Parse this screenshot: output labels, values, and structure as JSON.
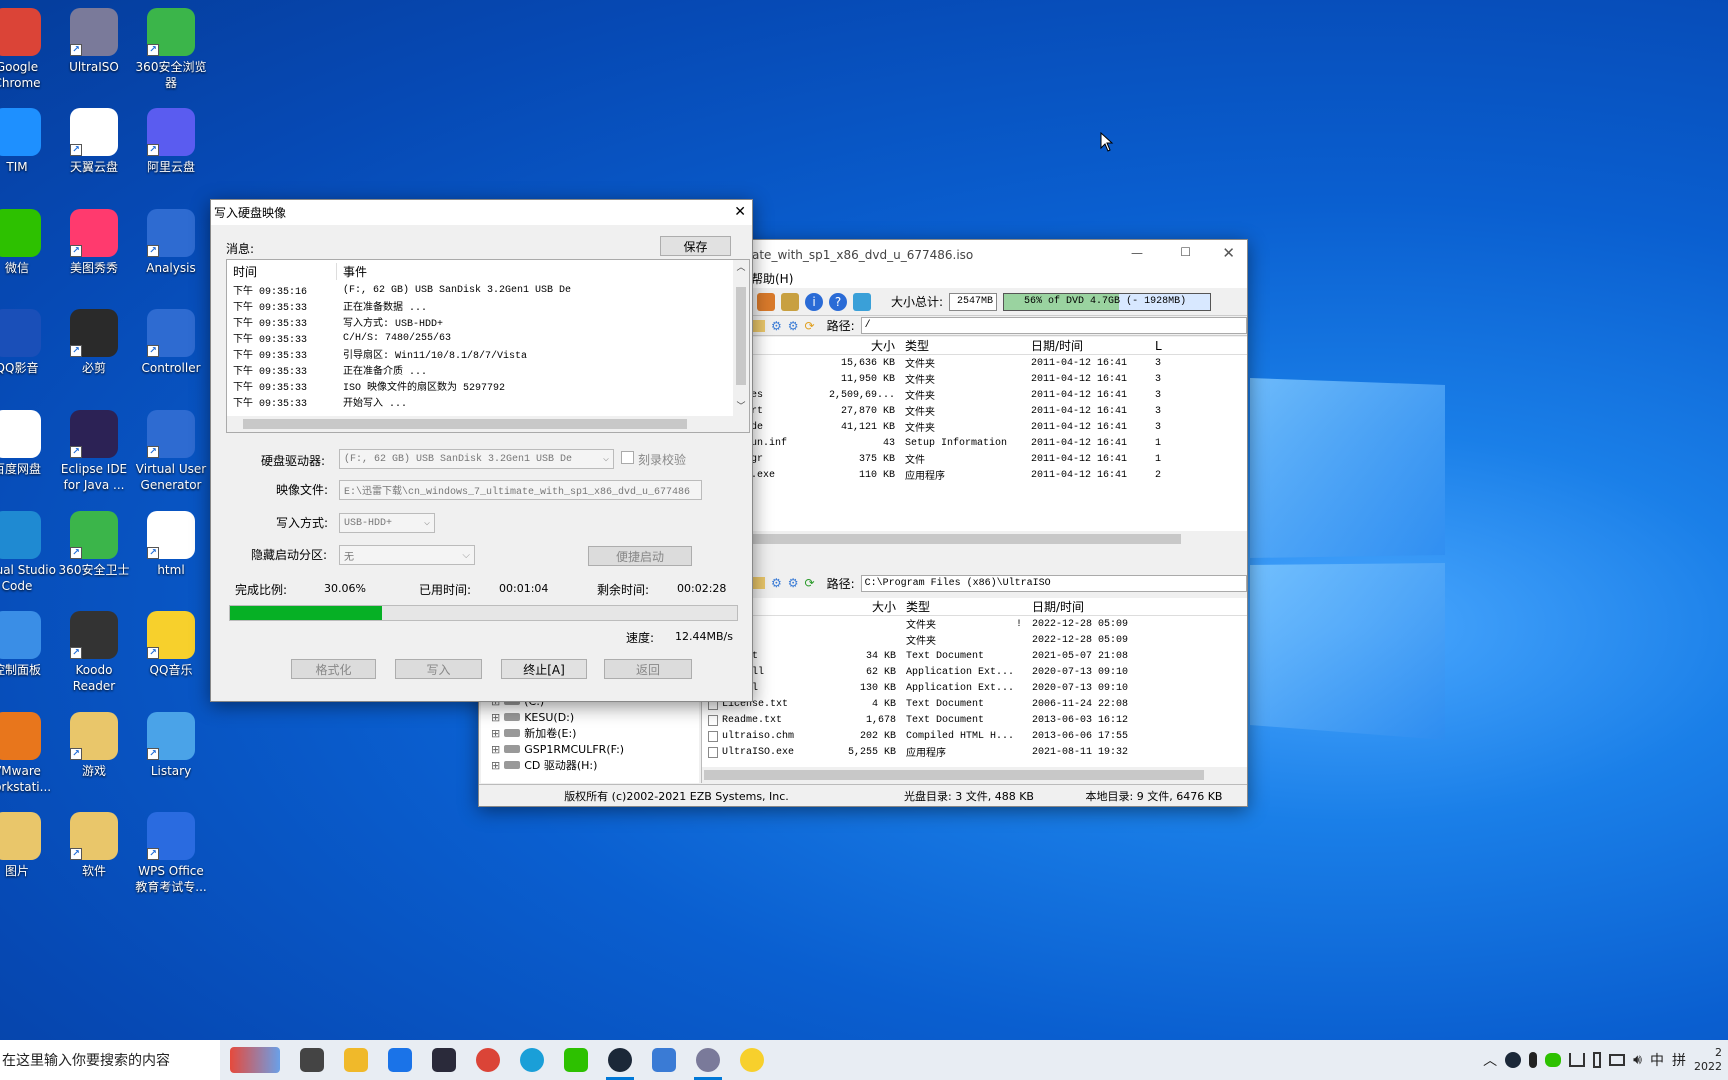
{
  "desktop_icons": [
    {
      "label": "Google Chrome",
      "color": "#db4437"
    },
    {
      "label": "UltraISO",
      "color": "#7a7a9a"
    },
    {
      "label": "360安全浏览器",
      "color": "#3bb54a"
    },
    {
      "label": "TIM",
      "color": "#1e90ff"
    },
    {
      "label": "天翼云盘",
      "color": "#ffffff"
    },
    {
      "label": "阿里云盘",
      "color": "#5a5cf0"
    },
    {
      "label": "微信",
      "color": "#2dc100"
    },
    {
      "label": "美图秀秀",
      "color": "#ff3a6e"
    },
    {
      "label": "Analysis",
      "color": "#2e6bd1"
    },
    {
      "label": "QQ影音",
      "color": "#1a4fb8"
    },
    {
      "label": "必剪",
      "color": "#2a2a2a"
    },
    {
      "label": "Controller",
      "color": "#2e6bd1"
    },
    {
      "label": "百度网盘",
      "color": "#ffffff"
    },
    {
      "label": "Eclipse IDE for Java ...",
      "color": "#2c2255"
    },
    {
      "label": "Virtual User Generator",
      "color": "#2e6bd1"
    },
    {
      "label": "Visual Studio Code",
      "color": "#1f8ad2"
    },
    {
      "label": "360安全卫士",
      "color": "#3bb54a"
    },
    {
      "label": "html",
      "color": "#ffffff"
    },
    {
      "label": "控制面板",
      "color": "#3a8ee6"
    },
    {
      "label": "Koodo Reader",
      "color": "#333333"
    },
    {
      "label": "QQ音乐",
      "color": "#f7d02c"
    },
    {
      "label": "VMware Workstati...",
      "color": "#e8761c"
    },
    {
      "label": "游戏",
      "color": "#e9c66a"
    },
    {
      "label": "Listary",
      "color": "#4aa3e8"
    },
    {
      "label": "图片",
      "color": "#e9c66a"
    },
    {
      "label": "软件",
      "color": "#e9c66a"
    },
    {
      "label": "WPS Office 教育考试专...",
      "color": "#2a6be0"
    }
  ],
  "dialog": {
    "title": "写入硬盘映像",
    "msg_label": "消息:",
    "save_btn": "保存",
    "log_header": {
      "time": "时间",
      "event": "事件"
    },
    "log": [
      {
        "t": "下午 09:35:16",
        "e": "(F:, 62 GB) USB  SanDisk 3.2Gen1 USB De"
      },
      {
        "t": "下午 09:35:33",
        "e": "正在准备数据 ..."
      },
      {
        "t": "下午 09:35:33",
        "e": "写入方式: USB-HDD+"
      },
      {
        "t": "下午 09:35:33",
        "e": "C/H/S: 7480/255/63"
      },
      {
        "t": "下午 09:35:33",
        "e": "引导扇区: Win11/10/8.1/8/7/Vista"
      },
      {
        "t": "下午 09:35:33",
        "e": "正在准备介质 ..."
      },
      {
        "t": "下午 09:35:33",
        "e": "ISO 映像文件的扇区数为 5297792"
      },
      {
        "t": "下午 09:35:33",
        "e": "开始写入 ..."
      }
    ],
    "drive_label": "硬盘驱动器:",
    "drive_value": "(F:, 62 GB) USB  SanDisk 3.2Gen1 USB De",
    "verify_label": "刻录校验",
    "image_label": "映像文件:",
    "image_value": "E:\\迅雷下载\\cn_windows_7_ultimate_with_sp1_x86_dvd_u_677486",
    "mode_label": "写入方式:",
    "mode_value": "USB-HDD+",
    "hidden_label": "隐藏启动分区:",
    "hidden_value": "无",
    "quick_boot": "便捷启动",
    "done_label": "完成比例:",
    "done_value": "30.06%",
    "progress": 0.3006,
    "elapsed_label": "已用时间:",
    "elapsed_value": "00:01:04",
    "remain_label": "剩余时间:",
    "remain_value": "00:02:28",
    "speed_label": "速度:",
    "speed_value": "12.44MB/s",
    "btn_format": "格式化",
    "btn_write": "写入",
    "btn_abort": "终止[A]",
    "btn_back": "返回"
  },
  "ultraiso": {
    "title": "ate_with_sp1_x86_dvd_u_677486.iso",
    "menu_help": "帮助(H)",
    "size_label": "大小总计:",
    "size_value": "2547MB",
    "bar_text": "56% of DVD 4.7GB (- 1928MB)",
    "bar_fill": 0.56,
    "path_label": "路径:",
    "path_top": "/",
    "path_bottom": "C:\\Program Files (x86)\\UltraISO",
    "headers": {
      "size": "大小",
      "type": "类型",
      "date": "日期/时间",
      "l": "L"
    },
    "top_files": [
      {
        "name": "",
        "size": "15,636 KB",
        "type": "文件夹",
        "date": "2011-04-12 16:41",
        "l": "3"
      },
      {
        "name": "",
        "size": "11,950 KB",
        "type": "文件夹",
        "date": "2011-04-12 16:41",
        "l": "3"
      },
      {
        "name": "es",
        "size": "2,509,69...",
        "type": "文件夹",
        "date": "2011-04-12 16:41",
        "l": "3"
      },
      {
        "name": "rt",
        "size": "27,870 KB",
        "type": "文件夹",
        "date": "2011-04-12 16:41",
        "l": "3"
      },
      {
        "name": "de",
        "size": "41,121 KB",
        "type": "文件夹",
        "date": "2011-04-12 16:41",
        "l": "3"
      },
      {
        "name": "un.inf",
        "size": "43",
        "type": "Setup Information",
        "date": "2011-04-12 16:41",
        "l": "1"
      },
      {
        "name": "gr",
        "size": "375 KB",
        "type": "文件",
        "date": "2011-04-12 16:41",
        "l": "1"
      },
      {
        "name": ".exe",
        "size": "110 KB",
        "type": "应用程序",
        "date": "2011-04-12 16:41",
        "l": "2"
      }
    ],
    "bottom_files": [
      {
        "name": "p",
        "size": "",
        "type": "文件夹",
        "date": "2022-12-28 05:09",
        "flag": "!"
      },
      {
        "name": "rs",
        "size": "",
        "type": "文件夹",
        "date": "2022-12-28 05:09",
        "flag": ""
      },
      {
        "name": "ry.txt",
        "size": "34 KB",
        "type": "Text Document",
        "date": "2021-05-07 21:08",
        "flag": ""
      },
      {
        "name": "ell.dll",
        "size": "62 KB",
        "type": "Application Ext...",
        "date": "2020-07-13 09:10",
        "flag": ""
      },
      {
        "name": "64.dll",
        "size": "130 KB",
        "type": "Application Ext...",
        "date": "2020-07-13 09:10",
        "flag": ""
      },
      {
        "name": "License.txt",
        "size": "4 KB",
        "type": "Text Document",
        "date": "2006-11-24 22:08",
        "flag": ""
      },
      {
        "name": "Readme.txt",
        "size": "1,678",
        "type": "Text Document",
        "date": "2013-06-03 16:12",
        "flag": ""
      },
      {
        "name": "ultraiso.chm",
        "size": "202 KB",
        "type": "Compiled HTML H...",
        "date": "2013-06-06 17:55",
        "flag": ""
      },
      {
        "name": "UltraISO.exe",
        "size": "5,255 KB",
        "type": "应用程序",
        "date": "2021-08-11 19:32",
        "flag": ""
      }
    ],
    "tree": [
      {
        "label": "(C:)"
      },
      {
        "label": "KESU(D:)"
      },
      {
        "label": "新加卷(E:)"
      },
      {
        "label": "GSP1RMCULFR(F:)"
      },
      {
        "label": "CD 驱动器(H:)"
      }
    ],
    "status_copyright": "版权所有 (c)2002-2021 EZB Systems, Inc.",
    "status_disc": "光盘目录: 3 文件, 488 KB",
    "status_local": "本地目录: 9 文件, 6476 KB"
  },
  "taskbar": {
    "search_placeholder": "在这里输入你要搜索的内容",
    "apps": [
      {
        "name": "task-view",
        "color": "#444"
      },
      {
        "name": "file-explorer",
        "color": "#f0b92a"
      },
      {
        "name": "feishu",
        "color": "#1a73e8"
      },
      {
        "name": "cat-app",
        "color": "#2a2a3a"
      },
      {
        "name": "chrome",
        "color": "#db4437"
      },
      {
        "name": "edge",
        "color": "#1a9fd8"
      },
      {
        "name": "wechat",
        "color": "#2dc100"
      },
      {
        "name": "steam",
        "color": "#1b2838"
      },
      {
        "name": "settings",
        "color": "#3a7bd5"
      },
      {
        "name": "ultraiso",
        "color": "#7a7a9a"
      },
      {
        "name": "qq-music",
        "color": "#f7d02c"
      }
    ],
    "ime": "中",
    "ime2": "拼",
    "clock_top": "2",
    "clock_bottom": "2022"
  }
}
